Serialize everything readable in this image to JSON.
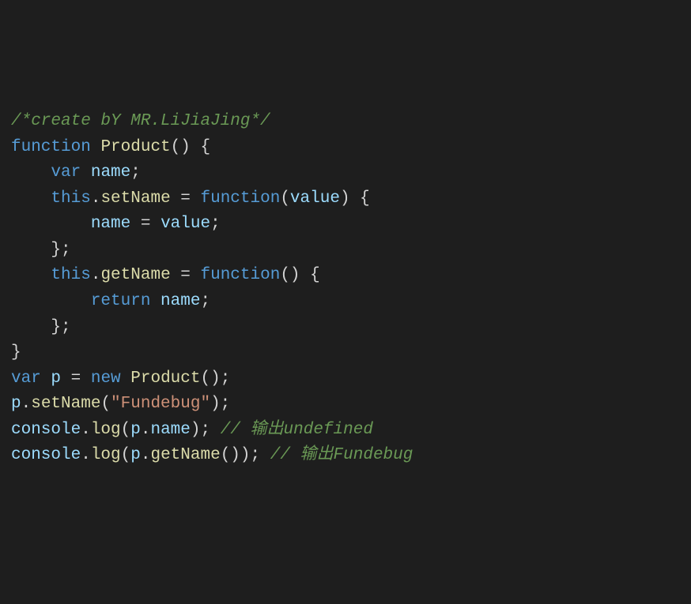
{
  "code": {
    "line1": {
      "comment": "/*create bY MR.LiJiaJing*/"
    },
    "line2": {
      "keyword_function": "function",
      "function_name": "Product",
      "parens": "()",
      "brace": " {"
    },
    "line3": {
      "empty": ""
    },
    "line4": {
      "indent": "    ",
      "keyword_var": "var",
      "variable": " name",
      "semi": ";"
    },
    "line5": {
      "empty": ""
    },
    "line6": {
      "indent": "    ",
      "this": "this",
      "dot": ".",
      "method": "setName",
      "equals": " = ",
      "keyword_function": "function",
      "paren_open": "(",
      "param": "value",
      "paren_close": ")",
      "brace": " {"
    },
    "line7": {
      "indent": "        ",
      "variable": "name",
      "equals": " = ",
      "value": "value",
      "semi": ";"
    },
    "line8": {
      "indent": "    ",
      "close": "};"
    },
    "line9": {
      "empty": ""
    },
    "line10": {
      "indent": "    ",
      "this": "this",
      "dot": ".",
      "method": "getName",
      "equals": " = ",
      "keyword_function": "function",
      "parens": "()",
      "brace": " {"
    },
    "line11": {
      "indent": "        ",
      "keyword_return": "return",
      "variable": " name",
      "semi": ";"
    },
    "line12": {
      "indent": "    ",
      "close": "};"
    },
    "line13": {
      "close": "}"
    },
    "line14": {
      "empty": ""
    },
    "line15": {
      "keyword_var": "var",
      "variable": " p",
      "equals": " = ",
      "keyword_new": "new",
      "space": " ",
      "function_name": "Product",
      "parens": "();"
    },
    "line16": {
      "object": "p",
      "dot": ".",
      "method": "setName",
      "paren_open": "(",
      "string": "\"Fundebug\"",
      "paren_close": ");"
    },
    "line17": {
      "empty": ""
    },
    "line18": {
      "object": "console",
      "dot": ".",
      "method": "log",
      "paren_open": "(",
      "object2": "p",
      "dot2": ".",
      "property": "name",
      "paren_close": ");",
      "space": " ",
      "comment": "// 输出undefined"
    },
    "line19": {
      "object": "console",
      "dot": ".",
      "method": "log",
      "paren_open": "(",
      "object2": "p",
      "dot2": ".",
      "method2": "getName",
      "parens": "()",
      "paren_close": ");",
      "space": " ",
      "comment": "// 输出Fundebug"
    }
  }
}
